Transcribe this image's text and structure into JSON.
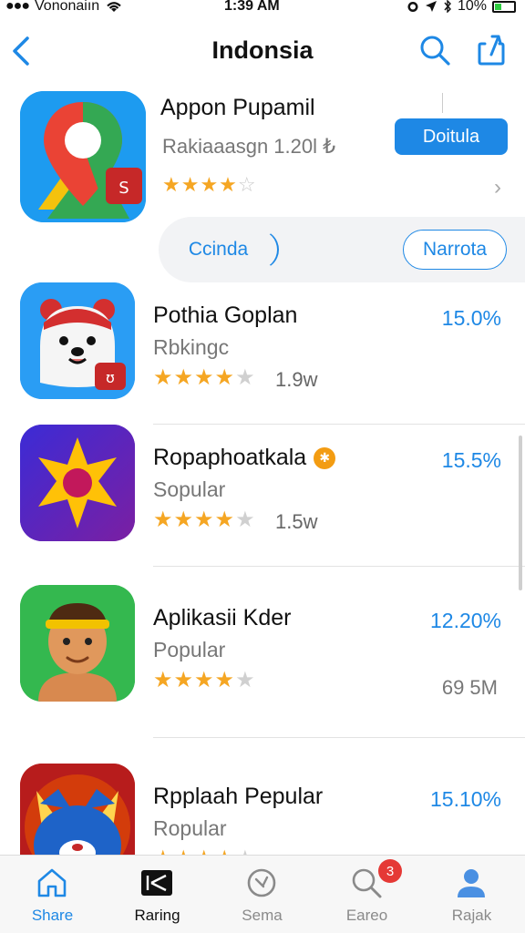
{
  "status_bar": {
    "carrier": "Vononaiın",
    "time": "1:39 AM",
    "battery": "10%"
  },
  "nav": {
    "title": "Indonsia"
  },
  "featured": {
    "name": "Appon Pupamil",
    "subtitle": "Rakiaaasgn 1.20l ₺",
    "rating": 4,
    "button_label": "Doitula",
    "left_pill": "Ccinda",
    "right_pill": "Narrota"
  },
  "apps": [
    {
      "name": "Pothia Goplan",
      "category": "Rbkingc",
      "rating": 4,
      "downloads": "1.9w",
      "percent": "15.0%",
      "side": ""
    },
    {
      "name": "Ropaphoatkala",
      "category": "Sopular",
      "rating": 4,
      "downloads": "1.5w",
      "percent": "15.5%",
      "side": "",
      "verified": true
    },
    {
      "name": "Aplikasii Kder",
      "category": "Popular",
      "rating": 4,
      "downloads": "",
      "percent": "12.20%",
      "side": "69 5M"
    },
    {
      "name": "Rpplaah Pepular",
      "category": "Ropular",
      "rating": 4,
      "downloads": "",
      "percent": "15.10%",
      "side": ""
    }
  ],
  "tabs": [
    {
      "label": "Share",
      "icon": "home-icon"
    },
    {
      "label": "Raring",
      "icon": "clapper-icon"
    },
    {
      "label": "Sema",
      "icon": "search-icon"
    },
    {
      "label": "Eareo",
      "icon": "search-badge-icon",
      "badge": "3"
    },
    {
      "label": "Rajak",
      "icon": "person-icon"
    }
  ],
  "colors": {
    "accent": "#1e88e5",
    "star": "#f5a623",
    "badge": "#e53935"
  }
}
